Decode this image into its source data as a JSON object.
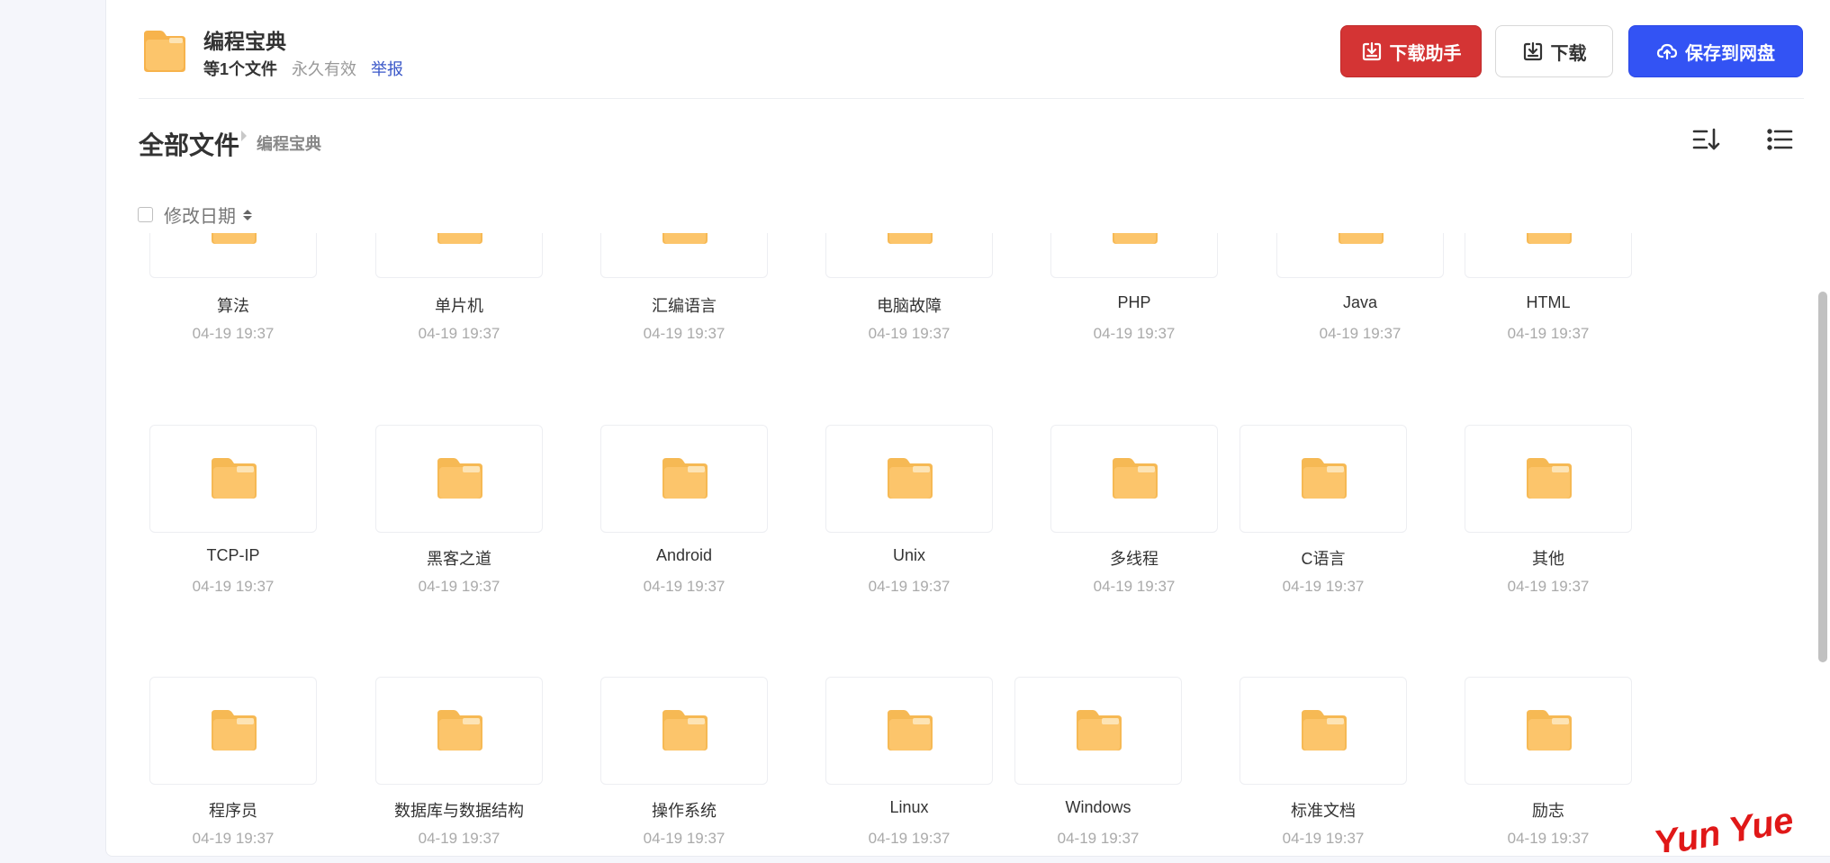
{
  "share": {
    "title": "编程宝典",
    "file_count": "等1个文件",
    "validity": "永久有效",
    "report_label": "举报"
  },
  "buttons": {
    "helper": "下载助手",
    "download": "下载",
    "save": "保存到网盘"
  },
  "breadcrumb": {
    "root": "全部文件",
    "current": "编程宝典"
  },
  "sort": {
    "label": "修改日期"
  },
  "files": [
    {
      "name": "算法",
      "date": "04-19 19:37"
    },
    {
      "name": "单片机",
      "date": "04-19 19:37"
    },
    {
      "name": "汇编语言",
      "date": "04-19 19:37"
    },
    {
      "name": "电脑故障",
      "date": "04-19 19:37"
    },
    {
      "name": "PHP",
      "date": "04-19 19:37"
    },
    {
      "name": "Java",
      "date": "04-19 19:37"
    },
    {
      "name": "HTML",
      "date": "04-19 19:37"
    },
    {
      "name": "TCP-IP",
      "date": "04-19 19:37"
    },
    {
      "name": "黑客之道",
      "date": "04-19 19:37"
    },
    {
      "name": "Android",
      "date": "04-19 19:37"
    },
    {
      "name": "Unix",
      "date": "04-19 19:37"
    },
    {
      "name": "多线程",
      "date": "04-19 19:37"
    },
    {
      "name": "C语言",
      "date": "04-19 19:37"
    },
    {
      "name": "其他",
      "date": "04-19 19:37"
    },
    {
      "name": "程序员",
      "date": "04-19 19:37"
    },
    {
      "name": "数据库与数据结构",
      "date": "04-19 19:37"
    },
    {
      "name": "操作系统",
      "date": "04-19 19:37"
    },
    {
      "name": "Linux",
      "date": "04-19 19:37"
    },
    {
      "name": "Windows",
      "date": "04-19 19:37"
    },
    {
      "name": "标准文档",
      "date": "04-19 19:37"
    },
    {
      "name": "励志",
      "date": "04-19 19:37"
    }
  ],
  "watermark": "Yun Yue",
  "colors": {
    "folder": "#fcc56b",
    "folder_tab": "#fde4b5",
    "accent_blue": "#3353f4",
    "accent_red": "#d43434",
    "link": "#3a57c8"
  },
  "icons": {
    "header_folder": "folder-icon",
    "helper": "download-box-icon",
    "download": "download-box-icon",
    "save": "cloud-upload-icon",
    "sort_toggle": "sort-list-icon",
    "view_toggle": "list-view-icon"
  }
}
